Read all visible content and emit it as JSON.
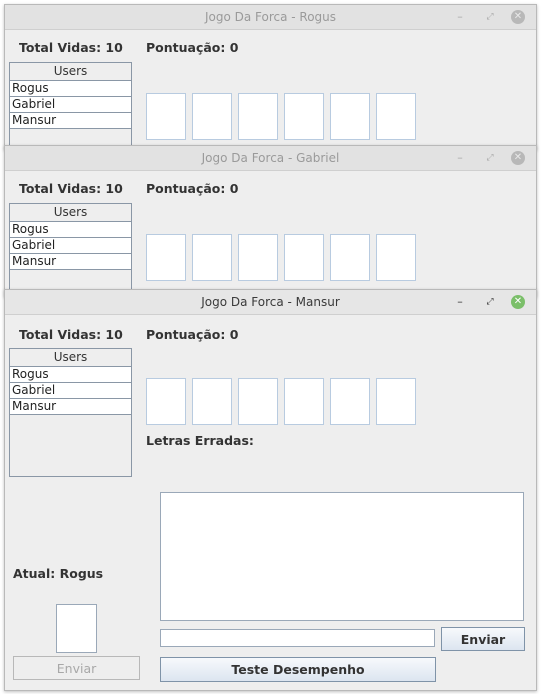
{
  "windows": [
    {
      "title": "Jogo Da Forca - Rogus",
      "vidas": "Total Vidas: 10",
      "pontuacao": "Pontuação: 0",
      "users_header": "Users",
      "users": [
        "Rogus",
        "Gabriel",
        "Mansur"
      ]
    },
    {
      "title": "Jogo Da Forca - Gabriel",
      "vidas": "Total Vidas: 10",
      "pontuacao": "Pontuação: 0",
      "users_header": "Users",
      "users": [
        "Rogus",
        "Gabriel",
        "Mansur"
      ]
    },
    {
      "title": "Jogo Da Forca - Mansur",
      "vidas": "Total Vidas: 10",
      "pontuacao": "Pontuação: 0",
      "users_header": "Users",
      "users": [
        "Rogus",
        "Gabriel",
        "Mansur"
      ],
      "letras_erradas": "Letras Erradas:",
      "atual": "Atual: Rogus",
      "chat_input_value": "",
      "letter_input_value": "",
      "enviar_chat_label": "Enviar",
      "enviar_letra_label": "Enviar",
      "teste_label": "Teste Desempenho"
    }
  ],
  "window_controls": {
    "minimize": "–",
    "maximize": "⤢",
    "close": "✕"
  },
  "colors": {
    "active_close": "#7bbf6a",
    "window_bg": "#eeeeee",
    "box_border": "#b8cbe0"
  }
}
